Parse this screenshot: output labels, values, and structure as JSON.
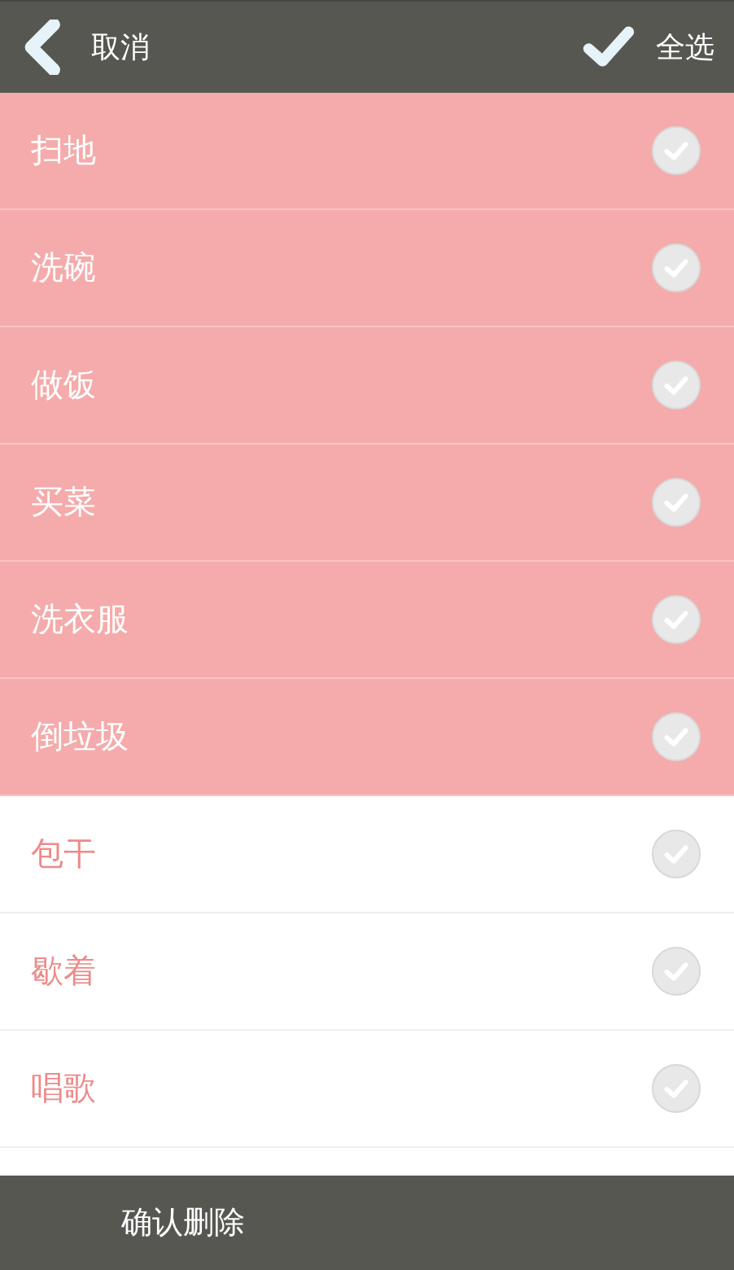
{
  "header": {
    "back_label": "取消",
    "select_all_label": "全选"
  },
  "items": [
    {
      "label": "扫地",
      "selected": true
    },
    {
      "label": "洗碗",
      "selected": true
    },
    {
      "label": "做饭",
      "selected": true
    },
    {
      "label": "买菜",
      "selected": true
    },
    {
      "label": "洗衣服",
      "selected": true
    },
    {
      "label": "倒垃圾",
      "selected": true
    },
    {
      "label": "包干",
      "selected": false
    },
    {
      "label": "歇着",
      "selected": false
    },
    {
      "label": "唱歌",
      "selected": false
    }
  ],
  "bottom_bar": {
    "confirm_label": "确认删除"
  }
}
